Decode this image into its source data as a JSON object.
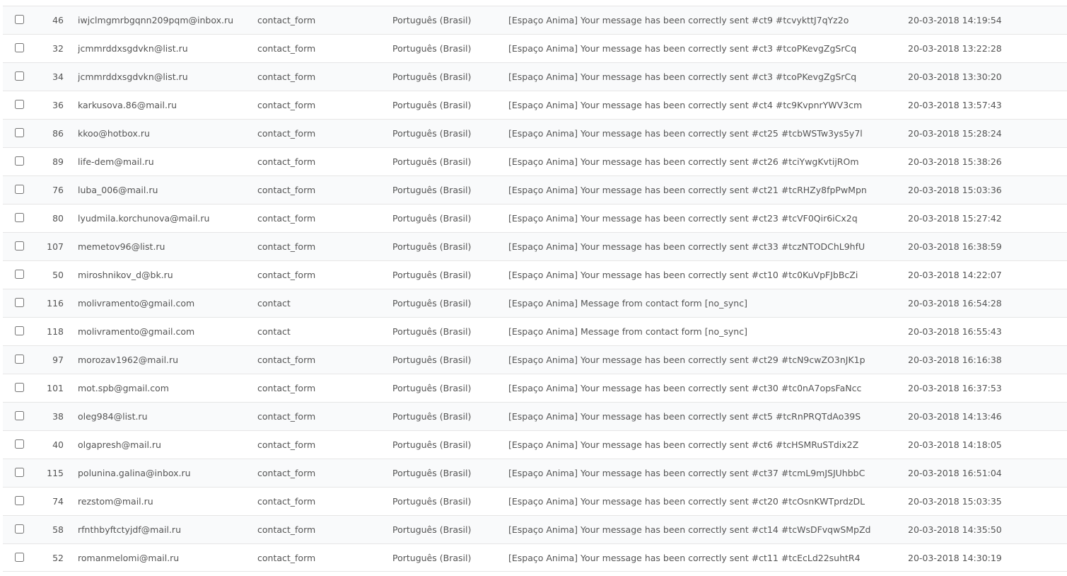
{
  "rows": [
    {
      "id": "46",
      "email": "iwjclmgmrbgqnn209pqm@inbox.ru",
      "template": "contact_form",
      "language": "Português (Brasil)",
      "subject": "[Espaço Anima] Your message has been correctly sent #ct9 #tcvykttJ7qYz2o",
      "date": "20-03-2018 14:19:54"
    },
    {
      "id": "32",
      "email": "jcmmrddxsgdvkn@list.ru",
      "template": "contact_form",
      "language": "Português (Brasil)",
      "subject": "[Espaço Anima] Your message has been correctly sent #ct3 #tcoPKevgZgSrCq",
      "date": "20-03-2018 13:22:28"
    },
    {
      "id": "34",
      "email": "jcmmrddxsgdvkn@list.ru",
      "template": "contact_form",
      "language": "Português (Brasil)",
      "subject": "[Espaço Anima] Your message has been correctly sent #ct3 #tcoPKevgZgSrCq",
      "date": "20-03-2018 13:30:20"
    },
    {
      "id": "36",
      "email": "karkusova.86@mail.ru",
      "template": "contact_form",
      "language": "Português (Brasil)",
      "subject": "[Espaço Anima] Your message has been correctly sent #ct4 #tc9KvpnrYWV3cm",
      "date": "20-03-2018 13:57:43"
    },
    {
      "id": "86",
      "email": "kkoo@hotbox.ru",
      "template": "contact_form",
      "language": "Português (Brasil)",
      "subject": "[Espaço Anima] Your message has been correctly sent #ct25 #tcbWSTw3ys5y7l",
      "date": "20-03-2018 15:28:24"
    },
    {
      "id": "89",
      "email": "life-dem@mail.ru",
      "template": "contact_form",
      "language": "Português (Brasil)",
      "subject": "[Espaço Anima] Your message has been correctly sent #ct26 #tciYwgKvtijROm",
      "date": "20-03-2018 15:38:26"
    },
    {
      "id": "76",
      "email": "luba_006@mail.ru",
      "template": "contact_form",
      "language": "Português (Brasil)",
      "subject": "[Espaço Anima] Your message has been correctly sent #ct21 #tcRHZy8fpPwMpn",
      "date": "20-03-2018 15:03:36"
    },
    {
      "id": "80",
      "email": "lyudmila.korchunova@mail.ru",
      "template": "contact_form",
      "language": "Português (Brasil)",
      "subject": "[Espaço Anima] Your message has been correctly sent #ct23 #tcVF0Qir6iCx2q",
      "date": "20-03-2018 15:27:42"
    },
    {
      "id": "107",
      "email": "memetov96@list.ru",
      "template": "contact_form",
      "language": "Português (Brasil)",
      "subject": "[Espaço Anima] Your message has been correctly sent #ct33 #tczNTODChL9hfU",
      "date": "20-03-2018 16:38:59"
    },
    {
      "id": "50",
      "email": "miroshnikov_d@bk.ru",
      "template": "contact_form",
      "language": "Português (Brasil)",
      "subject": "[Espaço Anima] Your message has been correctly sent #ct10 #tc0KuVpFJbBcZi",
      "date": "20-03-2018 14:22:07"
    },
    {
      "id": "116",
      "email": "molivramento@gmail.com",
      "template": "contact",
      "language": "Português (Brasil)",
      "subject": "[Espaço Anima] Message from contact form [no_sync]",
      "date": "20-03-2018 16:54:28"
    },
    {
      "id": "118",
      "email": "molivramento@gmail.com",
      "template": "contact",
      "language": "Português (Brasil)",
      "subject": "[Espaço Anima] Message from contact form [no_sync]",
      "date": "20-03-2018 16:55:43"
    },
    {
      "id": "97",
      "email": "morozav1962@mail.ru",
      "template": "contact_form",
      "language": "Português (Brasil)",
      "subject": "[Espaço Anima] Your message has been correctly sent #ct29 #tcN9cwZO3nJK1p",
      "date": "20-03-2018 16:16:38"
    },
    {
      "id": "101",
      "email": "mot.spb@gmail.com",
      "template": "contact_form",
      "language": "Português (Brasil)",
      "subject": "[Espaço Anima] Your message has been correctly sent #ct30 #tc0nA7opsFaNcc",
      "date": "20-03-2018 16:37:53"
    },
    {
      "id": "38",
      "email": "oleg984@list.ru",
      "template": "contact_form",
      "language": "Português (Brasil)",
      "subject": "[Espaço Anima] Your message has been correctly sent #ct5 #tcRnPRQTdAo39S",
      "date": "20-03-2018 14:13:46"
    },
    {
      "id": "40",
      "email": "olgapresh@mail.ru",
      "template": "contact_form",
      "language": "Português (Brasil)",
      "subject": "[Espaço Anima] Your message has been correctly sent #ct6 #tcHSMRuSTdix2Z",
      "date": "20-03-2018 14:18:05"
    },
    {
      "id": "115",
      "email": "polunina.galina@inbox.ru",
      "template": "contact_form",
      "language": "Português (Brasil)",
      "subject": "[Espaço Anima] Your message has been correctly sent #ct37 #tcmL9mJSJUhbbC",
      "date": "20-03-2018 16:51:04"
    },
    {
      "id": "74",
      "email": "rezstom@mail.ru",
      "template": "contact_form",
      "language": "Português (Brasil)",
      "subject": "[Espaço Anima] Your message has been correctly sent #ct20 #tcOsnKWTprdzDL",
      "date": "20-03-2018 15:03:35"
    },
    {
      "id": "58",
      "email": "rfnthbyftctyjdf@mail.ru",
      "template": "contact_form",
      "language": "Português (Brasil)",
      "subject": "[Espaço Anima] Your message has been correctly sent #ct14 #tcWsDFvqwSMpZd",
      "date": "20-03-2018 14:35:50"
    },
    {
      "id": "52",
      "email": "romanmelomi@mail.ru",
      "template": "contact_form",
      "language": "Português (Brasil)",
      "subject": "[Espaço Anima] Your message has been correctly sent #ct11 #tcEcLd22suhtR4",
      "date": "20-03-2018 14:30:19"
    }
  ]
}
